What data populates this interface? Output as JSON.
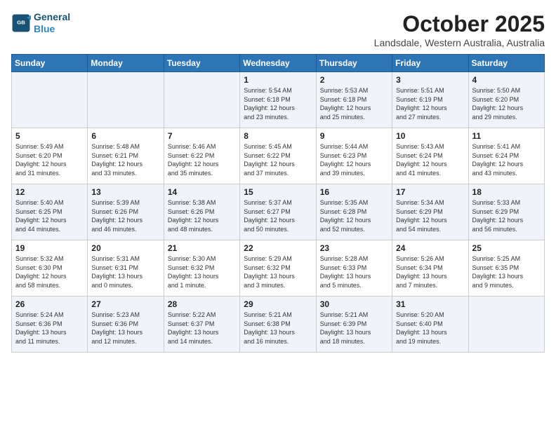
{
  "logo": {
    "line1": "General",
    "line2": "Blue"
  },
  "header": {
    "month": "October 2025",
    "location": "Landsdale, Western Australia, Australia"
  },
  "weekdays": [
    "Sunday",
    "Monday",
    "Tuesday",
    "Wednesday",
    "Thursday",
    "Friday",
    "Saturday"
  ],
  "weeks": [
    [
      {
        "day": "",
        "detail": ""
      },
      {
        "day": "",
        "detail": ""
      },
      {
        "day": "",
        "detail": ""
      },
      {
        "day": "1",
        "detail": "Sunrise: 5:54 AM\nSunset: 6:18 PM\nDaylight: 12 hours\nand 23 minutes."
      },
      {
        "day": "2",
        "detail": "Sunrise: 5:53 AM\nSunset: 6:18 PM\nDaylight: 12 hours\nand 25 minutes."
      },
      {
        "day": "3",
        "detail": "Sunrise: 5:51 AM\nSunset: 6:19 PM\nDaylight: 12 hours\nand 27 minutes."
      },
      {
        "day": "4",
        "detail": "Sunrise: 5:50 AM\nSunset: 6:20 PM\nDaylight: 12 hours\nand 29 minutes."
      }
    ],
    [
      {
        "day": "5",
        "detail": "Sunrise: 5:49 AM\nSunset: 6:20 PM\nDaylight: 12 hours\nand 31 minutes."
      },
      {
        "day": "6",
        "detail": "Sunrise: 5:48 AM\nSunset: 6:21 PM\nDaylight: 12 hours\nand 33 minutes."
      },
      {
        "day": "7",
        "detail": "Sunrise: 5:46 AM\nSunset: 6:22 PM\nDaylight: 12 hours\nand 35 minutes."
      },
      {
        "day": "8",
        "detail": "Sunrise: 5:45 AM\nSunset: 6:22 PM\nDaylight: 12 hours\nand 37 minutes."
      },
      {
        "day": "9",
        "detail": "Sunrise: 5:44 AM\nSunset: 6:23 PM\nDaylight: 12 hours\nand 39 minutes."
      },
      {
        "day": "10",
        "detail": "Sunrise: 5:43 AM\nSunset: 6:24 PM\nDaylight: 12 hours\nand 41 minutes."
      },
      {
        "day": "11",
        "detail": "Sunrise: 5:41 AM\nSunset: 6:24 PM\nDaylight: 12 hours\nand 43 minutes."
      }
    ],
    [
      {
        "day": "12",
        "detail": "Sunrise: 5:40 AM\nSunset: 6:25 PM\nDaylight: 12 hours\nand 44 minutes."
      },
      {
        "day": "13",
        "detail": "Sunrise: 5:39 AM\nSunset: 6:26 PM\nDaylight: 12 hours\nand 46 minutes."
      },
      {
        "day": "14",
        "detail": "Sunrise: 5:38 AM\nSunset: 6:26 PM\nDaylight: 12 hours\nand 48 minutes."
      },
      {
        "day": "15",
        "detail": "Sunrise: 5:37 AM\nSunset: 6:27 PM\nDaylight: 12 hours\nand 50 minutes."
      },
      {
        "day": "16",
        "detail": "Sunrise: 5:35 AM\nSunset: 6:28 PM\nDaylight: 12 hours\nand 52 minutes."
      },
      {
        "day": "17",
        "detail": "Sunrise: 5:34 AM\nSunset: 6:29 PM\nDaylight: 12 hours\nand 54 minutes."
      },
      {
        "day": "18",
        "detail": "Sunrise: 5:33 AM\nSunset: 6:29 PM\nDaylight: 12 hours\nand 56 minutes."
      }
    ],
    [
      {
        "day": "19",
        "detail": "Sunrise: 5:32 AM\nSunset: 6:30 PM\nDaylight: 12 hours\nand 58 minutes."
      },
      {
        "day": "20",
        "detail": "Sunrise: 5:31 AM\nSunset: 6:31 PM\nDaylight: 13 hours\nand 0 minutes."
      },
      {
        "day": "21",
        "detail": "Sunrise: 5:30 AM\nSunset: 6:32 PM\nDaylight: 13 hours\nand 1 minute."
      },
      {
        "day": "22",
        "detail": "Sunrise: 5:29 AM\nSunset: 6:32 PM\nDaylight: 13 hours\nand 3 minutes."
      },
      {
        "day": "23",
        "detail": "Sunrise: 5:28 AM\nSunset: 6:33 PM\nDaylight: 13 hours\nand 5 minutes."
      },
      {
        "day": "24",
        "detail": "Sunrise: 5:26 AM\nSunset: 6:34 PM\nDaylight: 13 hours\nand 7 minutes."
      },
      {
        "day": "25",
        "detail": "Sunrise: 5:25 AM\nSunset: 6:35 PM\nDaylight: 13 hours\nand 9 minutes."
      }
    ],
    [
      {
        "day": "26",
        "detail": "Sunrise: 5:24 AM\nSunset: 6:36 PM\nDaylight: 13 hours\nand 11 minutes."
      },
      {
        "day": "27",
        "detail": "Sunrise: 5:23 AM\nSunset: 6:36 PM\nDaylight: 13 hours\nand 12 minutes."
      },
      {
        "day": "28",
        "detail": "Sunrise: 5:22 AM\nSunset: 6:37 PM\nDaylight: 13 hours\nand 14 minutes."
      },
      {
        "day": "29",
        "detail": "Sunrise: 5:21 AM\nSunset: 6:38 PM\nDaylight: 13 hours\nand 16 minutes."
      },
      {
        "day": "30",
        "detail": "Sunrise: 5:21 AM\nSunset: 6:39 PM\nDaylight: 13 hours\nand 18 minutes."
      },
      {
        "day": "31",
        "detail": "Sunrise: 5:20 AM\nSunset: 6:40 PM\nDaylight: 13 hours\nand 19 minutes."
      },
      {
        "day": "",
        "detail": ""
      }
    ]
  ]
}
